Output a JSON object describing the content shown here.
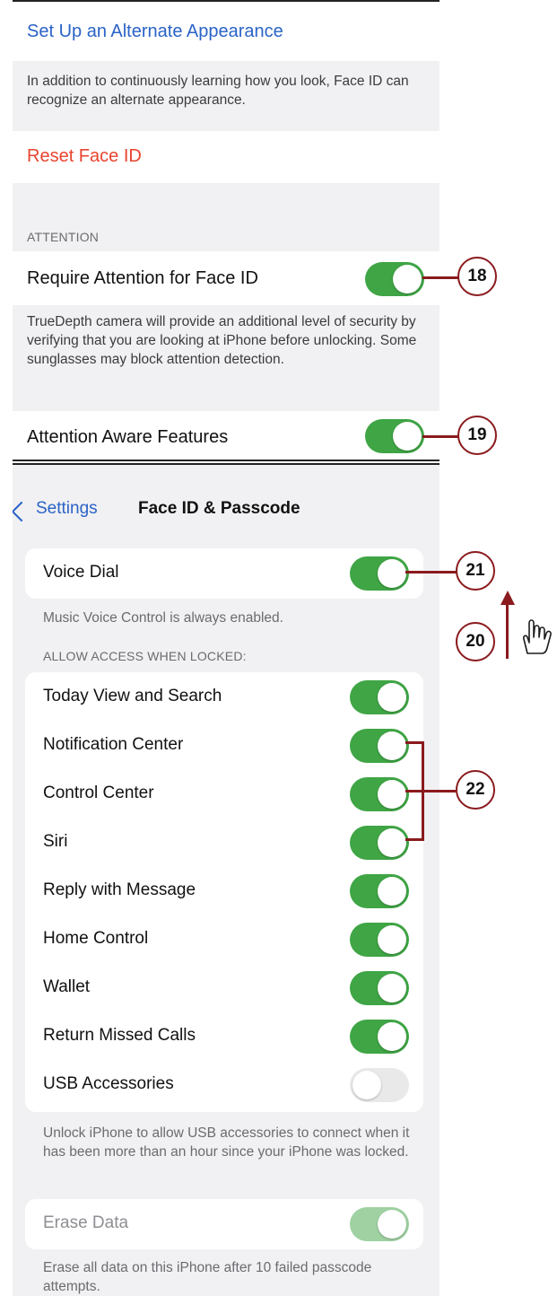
{
  "panel1": {
    "alternate_appearance_link": "Set Up an Alternate Appearance",
    "alternate_appearance_footer": "In addition to continuously learning how you look, Face ID can recognize an alternate appearance.",
    "reset_face_id": "Reset Face ID",
    "attention_header": "ATTENTION",
    "require_attention_label": "Require Attention for Face ID",
    "require_attention_footer": "TrueDepth camera will provide an additional level of security by verifying that you are looking at iPhone before unlocking. Some sunglasses may block attention detection.",
    "attention_aware_label": "Attention Aware Features"
  },
  "panel2": {
    "nav_back": "Settings",
    "nav_title": "Face ID & Passcode",
    "voice_dial_label": "Voice Dial",
    "voice_dial_footer": "Music Voice Control is always enabled.",
    "locked_header": "ALLOW ACCESS WHEN LOCKED:",
    "locked_items": [
      {
        "label": "Today View and Search",
        "on": true
      },
      {
        "label": "Notification Center",
        "on": true
      },
      {
        "label": "Control Center",
        "on": true
      },
      {
        "label": "Siri",
        "on": true
      },
      {
        "label": "Reply with Message",
        "on": true
      },
      {
        "label": "Home Control",
        "on": true
      },
      {
        "label": "Wallet",
        "on": true
      },
      {
        "label": "Return Missed Calls",
        "on": true
      },
      {
        "label": "USB Accessories",
        "on": false
      }
    ],
    "usb_footer": "Unlock iPhone to allow USB accessories to connect when it has been more than an hour since your iPhone was locked.",
    "erase_data_label": "Erase Data",
    "erase_data_footer": "Erase all data on this iPhone after 10 failed passcode attempts."
  },
  "callouts": {
    "c18": "18",
    "c19": "19",
    "c20": "20",
    "c21": "21",
    "c22": "22"
  },
  "colors": {
    "toggle_on": "#3fa545",
    "toggle_off": "#e9e9ea",
    "link_blue": "#2a63c7",
    "destructive_red": "#e8442f",
    "callout": "#8a1a1d"
  },
  "icons": [
    "chevron-left-icon",
    "swipe-up-hand-icon"
  ]
}
